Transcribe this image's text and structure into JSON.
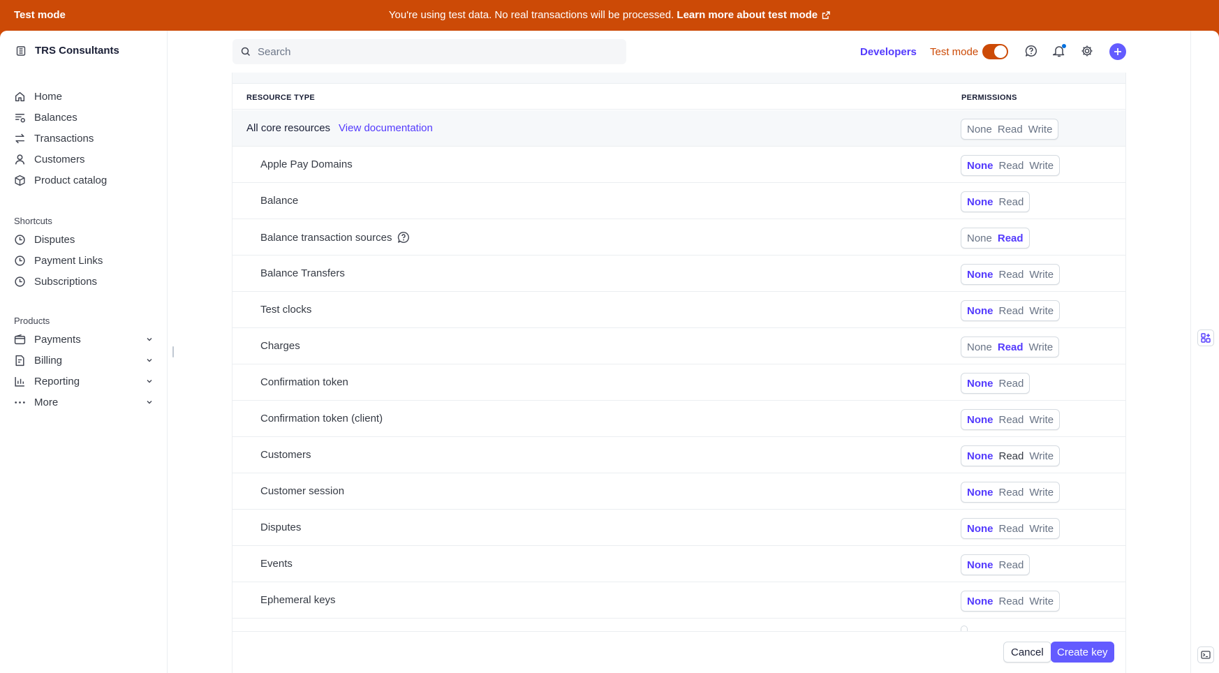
{
  "banner": {
    "label": "Test mode",
    "message": "You're using test data. No real transactions will be processed.",
    "link": "Learn more about test mode"
  },
  "account": {
    "name": "TRS Consultants"
  },
  "sidebar": {
    "main": [
      {
        "label": "Home",
        "icon": "home-icon"
      },
      {
        "label": "Balances",
        "icon": "balances-icon"
      },
      {
        "label": "Transactions",
        "icon": "transactions-icon"
      },
      {
        "label": "Customers",
        "icon": "customers-icon"
      },
      {
        "label": "Product catalog",
        "icon": "product-catalog-icon"
      }
    ],
    "shortcuts_label": "Shortcuts",
    "shortcuts": [
      {
        "label": "Disputes",
        "icon": "clock-icon"
      },
      {
        "label": "Payment Links",
        "icon": "clock-icon"
      },
      {
        "label": "Subscriptions",
        "icon": "clock-icon"
      }
    ],
    "products_label": "Products",
    "products": [
      {
        "label": "Payments",
        "icon": "wallet-icon"
      },
      {
        "label": "Billing",
        "icon": "billing-icon"
      },
      {
        "label": "Reporting",
        "icon": "bar-chart-icon"
      },
      {
        "label": "More",
        "icon": "ellipsis-icon"
      }
    ]
  },
  "topbar": {
    "search_placeholder": "Search",
    "developers": "Developers",
    "test_mode": "Test mode",
    "test_mode_on": true
  },
  "table": {
    "col_resource": "RESOURCE TYPE",
    "col_permissions": "PERMISSIONS",
    "core": {
      "name": "All core resources",
      "doc_link": "View documentation",
      "options": [
        "None",
        "Read",
        "Write"
      ],
      "selected": ""
    },
    "rows": [
      {
        "name": "Apple Pay Domains",
        "options": [
          "None",
          "Read",
          "Write"
        ],
        "selected": "None"
      },
      {
        "name": "Balance",
        "options": [
          "None",
          "Read"
        ],
        "selected": "None"
      },
      {
        "name": "Balance transaction sources",
        "help": true,
        "options": [
          "None",
          "Read"
        ],
        "selected": "Read"
      },
      {
        "name": "Balance Transfers",
        "options": [
          "None",
          "Read",
          "Write"
        ],
        "selected": "None"
      },
      {
        "name": "Test clocks",
        "options": [
          "None",
          "Read",
          "Write"
        ],
        "selected": "None"
      },
      {
        "name": "Charges",
        "options": [
          "None",
          "Read",
          "Write"
        ],
        "selected": "Read"
      },
      {
        "name": "Confirmation token",
        "options": [
          "None",
          "Read"
        ],
        "selected": "None"
      },
      {
        "name": "Confirmation token (client)",
        "options": [
          "None",
          "Read",
          "Write"
        ],
        "selected": "None"
      },
      {
        "name": "Customers",
        "options": [
          "None",
          "Read",
          "Write"
        ],
        "selected": "None",
        "hover": "Read"
      },
      {
        "name": "Customer session",
        "options": [
          "None",
          "Read",
          "Write"
        ],
        "selected": "None"
      },
      {
        "name": "Disputes",
        "options": [
          "None",
          "Read",
          "Write"
        ],
        "selected": "None"
      },
      {
        "name": "Events",
        "options": [
          "None",
          "Read"
        ],
        "selected": "None"
      },
      {
        "name": "Ephemeral keys",
        "options": [
          "None",
          "Read",
          "Write"
        ],
        "selected": "None"
      }
    ]
  },
  "footer": {
    "cancel": "Cancel",
    "create": "Create key"
  },
  "colors": {
    "accent": "#635bff",
    "test_orange": "#cc4a06"
  }
}
